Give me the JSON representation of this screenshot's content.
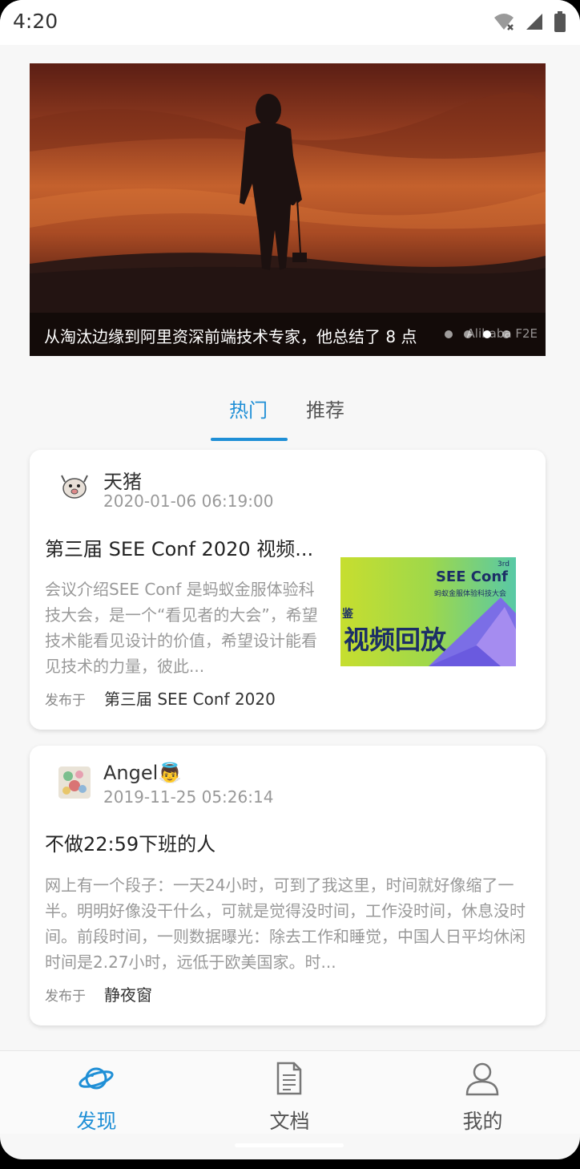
{
  "status_bar": {
    "time": "4:20"
  },
  "banner": {
    "caption": "从淘汰边缘到阿里资深前端技术专家，他总结了 8 点",
    "watermark": "Alibaba F2E",
    "dot_count": 4,
    "active_dot": 3
  },
  "tabs": [
    {
      "label": "热门",
      "active": true
    },
    {
      "label": "推荐",
      "active": false
    }
  ],
  "posts": [
    {
      "author": "天猪",
      "date": "2020-01-06 06:19:00",
      "title": "第三届 SEE Conf 2020 视频...",
      "summary": "会议介绍SEE Conf 是蚂蚁金服体验科技大会，是一个“看见者的大会”，希望技术能看见设计的价值，希望设计能看见技术的力量，彼此...",
      "published_label": "发布于",
      "published_in": "第三届 SEE Conf 2020",
      "thumbnail": {
        "conf": "SEE Conf",
        "edition": "3rd",
        "subtitle": "蚂蚁金服体验科技大会",
        "headline": "视频回放",
        "prefix": "鉴"
      }
    },
    {
      "author": "Angel👼",
      "date": "2019-11-25 05:26:14",
      "title": "不做22:59下班的人",
      "summary": "网上有一个段子：一天24小时，可到了我这里，时间就好像缩了一半。明明好像没干什么，可就是觉得没时间，工作没时间，休息没时间。前段时间，一则数据曝光：除去工作和睡觉，中国人日平均休闲时间是2.27小时，远低于欧美国家。时...",
      "published_label": "发布于",
      "published_in": "静夜窗"
    }
  ],
  "bottom_nav": [
    {
      "label": "发现",
      "icon": "planet-icon",
      "active": true
    },
    {
      "label": "文档",
      "icon": "document-icon",
      "active": false
    },
    {
      "label": "我的",
      "icon": "user-icon",
      "active": false
    }
  ],
  "colors": {
    "accent": "#1f8fd6",
    "background": "#f7f7f7"
  }
}
